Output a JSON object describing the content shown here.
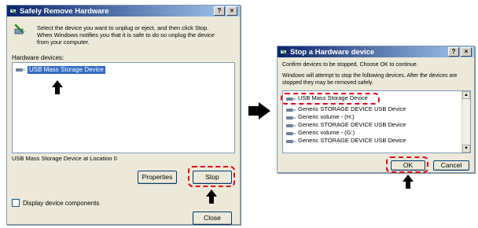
{
  "window1": {
    "title": "Safely Remove Hardware",
    "help_btn": "?",
    "close_btn": "×",
    "instructions": "Select the device you want to unplug or eject, and then click Stop. When Windows notifies you that it is safe to do so unplug the device from your computer.",
    "hw_label": "Hardware devices:",
    "selected_device": "USB Mass Storage Device",
    "location_text": "USB Mass Storage Device at Location 0",
    "properties_btn": "Properties",
    "stop_btn": "Stop",
    "display_components": "Display device components",
    "close_button": "Close"
  },
  "window2": {
    "title": "Stop a Hardware device",
    "help_btn": "?",
    "close_btn": "×",
    "confirm_text": "Confirm devices to be stopped, Choose OK to continue.",
    "attempt_text": "Windows will attempt to stop the following devices. After the devices are stopped they may be removed safely.",
    "devices": [
      "USB Mass Storage Device",
      "Generic STORAGE DEVICE USB Device",
      "Generic volume - (H:)",
      "Generic STORAGE DEVICE USB Device",
      "Generic volume - (G:)",
      "Generic STORAGE DEVICE USB Device"
    ],
    "ok_btn": "OK",
    "cancel_btn": "Cancel"
  },
  "colors": {
    "highlight": "#e2001a",
    "selection": "#316ac5",
    "titlebar": "#0a246a"
  },
  "icons": {
    "title_icon": "safely-remove-hardware-icon",
    "device_icon": "usb-device-icon",
    "arrow": "black-arrow-icon"
  }
}
